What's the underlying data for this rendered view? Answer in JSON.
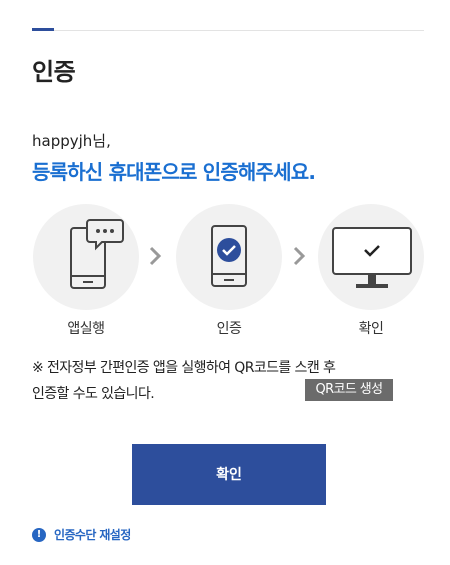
{
  "header": {
    "title": "인증"
  },
  "greeting": "happyjh님,",
  "headline": "등록하신 휴대폰으로 인증해주세요.",
  "steps": [
    {
      "label": "앱실행",
      "icon": "phone-chat-icon"
    },
    {
      "label": "인증",
      "icon": "phone-check-icon"
    },
    {
      "label": "확인",
      "icon": "monitor-check-icon"
    }
  ],
  "notice": {
    "line1": "※ 전자정부 간편인증 앱을 실행하여 QR코드를 스캔 후",
    "line2": "인증할 수도 있습니다."
  },
  "qr_button": "QR코드 생성",
  "confirm_button": "확인",
  "reset_link": {
    "icon": "info-icon",
    "label": "인증수단 재설정"
  },
  "colors": {
    "accent": "#2d4e9c",
    "headline": "#1a6fd1",
    "link": "#2766c2",
    "badge": "#6b6b6b"
  }
}
